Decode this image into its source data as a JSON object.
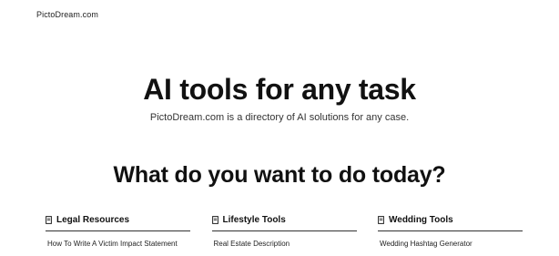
{
  "site": {
    "logo": "PictoDream.com"
  },
  "hero": {
    "title": "AI tools for any task",
    "subtitle": "PictoDream.com is a directory of AI solutions for any case."
  },
  "section": {
    "title": "What do you want to do today?"
  },
  "categories": [
    {
      "title": "Legal Resources",
      "icon": "document-icon",
      "links": [
        "How To Write A Victim Impact Statement"
      ]
    },
    {
      "title": "Lifestyle Tools",
      "icon": "document-icon",
      "links": [
        "Real Estate Description"
      ]
    },
    {
      "title": "Wedding Tools",
      "icon": "document-icon",
      "links": [
        "Wedding Hashtag Generator"
      ]
    }
  ]
}
